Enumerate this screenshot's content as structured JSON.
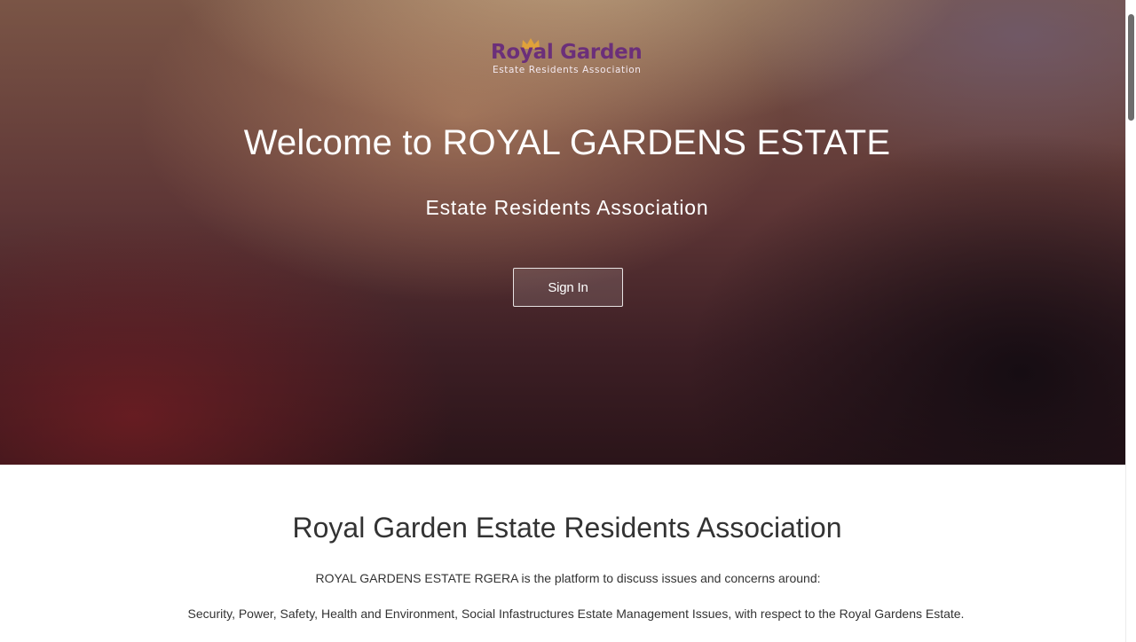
{
  "logo": {
    "title": "Royal Garden",
    "subtitle": "Estate Residents Association",
    "crown_icon": "crown-icon",
    "title_color": "#6b2f7a",
    "crown_color": "#e0a23a"
  },
  "hero": {
    "title": "Welcome to ROYAL GARDENS ESTATE",
    "subtitle": "Estate Residents Association",
    "signin_label": "Sign In"
  },
  "about": {
    "title": "Royal Garden Estate Residents Association",
    "intro": "ROYAL GARDENS ESTATE RGERA is the platform to discuss issues and concerns around:",
    "topics": "Security, Power, Safety, Health and Environment, Social Infastructures Estate Management Issues, with respect to the Royal Gardens Estate."
  }
}
